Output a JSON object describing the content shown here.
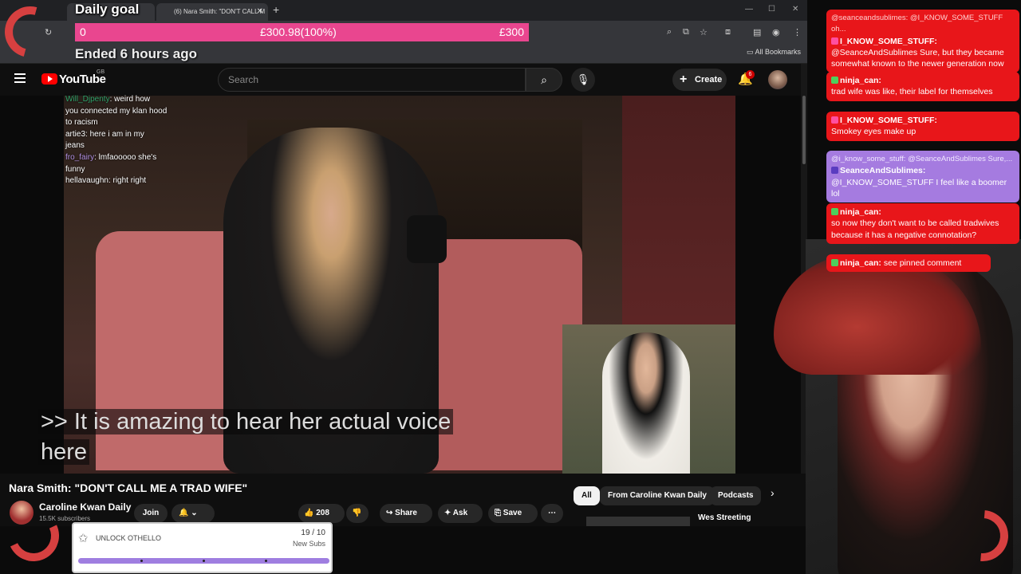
{
  "browser": {
    "tab_title": "(6) Nara Smith: \"DON'T CALL M",
    "all_bookmarks": "All Bookmarks"
  },
  "daily_goal": {
    "title": "Daily goal",
    "start": "0",
    "progress_text": "£300.98(100%)",
    "target": "£300",
    "progress_fraction": 1.0,
    "ended": "Ended 6 hours ago",
    "bar_color": "#e9468f"
  },
  "youtube": {
    "wordmark": "YouTube",
    "region": "GB",
    "search_placeholder": "Search",
    "create_label": "Create",
    "notification_count": "6"
  },
  "video": {
    "caption_line1": ">> It is amazing to hear her actual voice",
    "caption_line2": "here",
    "title": "Nara Smith: \"DON'T CALL ME A TRAD WIFE\"",
    "channel_name": "Caroline Kwan Daily",
    "channel_subs": "15.5K subscribers",
    "join_label": "Join",
    "like_count": "208",
    "share_label": "Share",
    "ask_label": "Ask",
    "save_label": "Save"
  },
  "video_chat": [
    {
      "user": "Will_Djpenty",
      "text": ": weird how"
    },
    {
      "user": "",
      "text": "you connected my klan hood"
    },
    {
      "user": "",
      "text": "to racism"
    },
    {
      "user": "artie3",
      "text": ": here i am in my"
    },
    {
      "user": "",
      "text": "jeans"
    },
    {
      "user": "fro_fairy",
      "text": ": lmfaooooo she's"
    },
    {
      "user": "",
      "text": "funny"
    },
    {
      "user": "hellavaughn",
      "text": ": right right"
    }
  ],
  "chips": [
    "All",
    "From Caroline Kwan Daily",
    "Podcasts"
  ],
  "recommendation_title": "Wes Streeting",
  "othello": {
    "label": "UNLOCK OTHELLO",
    "count": "19 / 10",
    "sub": "New Subs",
    "progress_fraction": 1.0
  },
  "side_chat": [
    {
      "reply": "@seanceandsublimes: @I_KNOW_SOME_STUFF oh...",
      "name": "I_KNOW_SOME_STUFF:",
      "text": "@SeanceAndSublimes Sure, but they became somewhat known to the newer generation now"
    },
    {
      "reply": "",
      "name": "ninja_can:",
      "text": "trad wife was like, their label for themselves"
    },
    {
      "reply": "",
      "name": "I_KNOW_SOME_STUFF:",
      "text": "Smokey eyes make up"
    },
    {
      "reply": "@i_know_some_stuff: @SeanceAndSublimes Sure,...",
      "name": "SeanceAndSublimes:",
      "text": "@I_KNOW_SOME_STUFF I feel like a boomer lol"
    },
    {
      "reply": "",
      "name": "ninja_can:",
      "text": "so now they don't want to be called tradwives because it has a negative connotation?"
    },
    {
      "reply": "",
      "name": "ninja_can:",
      "text": "see pinned comment"
    }
  ],
  "colors": {
    "chat_red": "#e8161a",
    "chat_purple": "#a57be0",
    "yt_red": "#ff0000"
  }
}
